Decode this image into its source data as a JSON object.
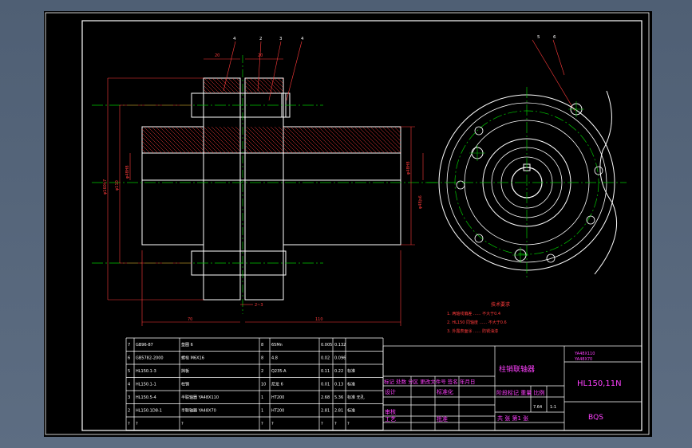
{
  "balloons": [
    "4",
    "2",
    "3",
    "4",
    "5",
    "6"
  ],
  "dimensions": {
    "top_a": "20",
    "top_b": "20",
    "left_big": "φ160h7",
    "left_mid": "φ110",
    "left_small": "φ48H8",
    "right_a": "φ48H8",
    "right_b": "φ48js6",
    "gap": "2~3",
    "len_left": "70",
    "len_right": "110"
  },
  "notes": {
    "heading": "技术要求",
    "line1": "1. 两轴线偏差 ...... 不大于0.4",
    "line2": "2. HL150 同轴度 ...... 不大于0.6",
    "line3": "3. 外露表面涂 ...... 防锈油漆"
  },
  "parts_rows": [
    {
      "no": "7",
      "code": "GB96-87",
      "name": "垫圈 6",
      "qty": "8",
      "mat": "65Mn",
      "w1": "0.005",
      "w2": "0.132",
      "note": ""
    },
    {
      "no": "6",
      "code": "GB5782-2000",
      "name": "螺栓 M6X16",
      "qty": "8",
      "mat": "4.8",
      "w1": "0.02",
      "w2": "0.096",
      "note": ""
    },
    {
      "no": "5",
      "code": "HL150.1-3",
      "name": "挡板",
      "qty": "2",
      "mat": "Q235-A",
      "w1": "0.11",
      "w2": "0.22",
      "note": "标准"
    },
    {
      "no": "4",
      "code": "HL150.1-1",
      "name": "柱销",
      "qty": "10",
      "mat": "尼龙 6",
      "w1": "0.01",
      "w2": "0.13",
      "note": "标准"
    },
    {
      "no": "3",
      "code": "HL150.5-4",
      "name": "半联轴器 YA48X110",
      "qty": "1",
      "mat": "HT200",
      "w1": "2.68",
      "w2": "5.36",
      "note": "标准 无孔"
    },
    {
      "no": "2",
      "code": "HL150.1D8-1",
      "name": "半联轴器 YA48X70",
      "qty": "1",
      "mat": "HT200",
      "w1": "2.81",
      "w2": "2.81",
      "note": "标准"
    },
    {
      "no": "?",
      "code": "?",
      "name": "?",
      "qty": "?",
      "mat": "?",
      "w1": "?",
      "w2": "?",
      "note": "?"
    }
  ],
  "title_block": {
    "name": "柱销联轴器",
    "spec_top1": "YA48X110",
    "spec_top2": "YA48X70",
    "model": "HL150,11N",
    "drawing_no": "BQS",
    "revision_header": "标记 处数 分区 更改文件号 签名 年月日",
    "design": "设计",
    "standard": "标准化",
    "review": "审核",
    "process": "工艺",
    "approve": "批准",
    "stage": "阶段标记 重量 比例",
    "weight": "7.64",
    "scale": "1:1",
    "sheet": "共 张 第1 张"
  },
  "colors": {
    "background": "#000000",
    "outline": "#ffffff",
    "dim": "#ff3b3b",
    "center": "#00c800",
    "hatch": "#ff3b3b",
    "magenta": "#ff40ff"
  }
}
